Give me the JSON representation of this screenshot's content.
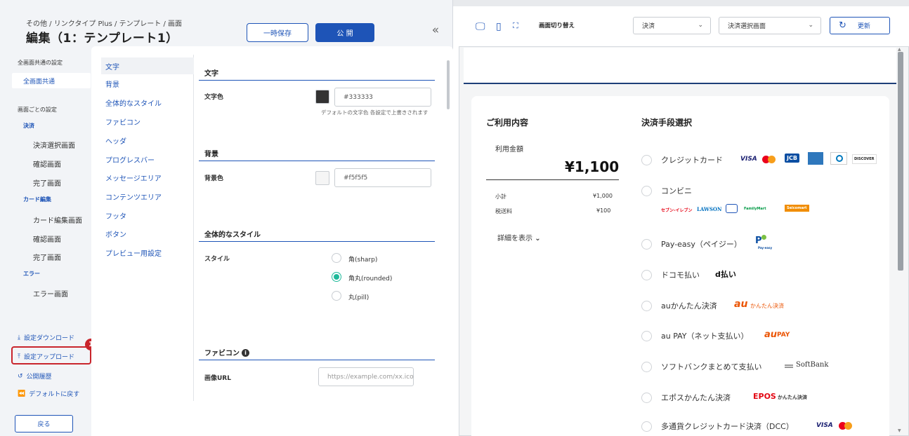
{
  "header": {
    "breadcrumb": "その他 / リンクタイプ Plus / テンプレート / 画面",
    "title": "編集（1：テンプレート1）",
    "save_label": "一時保存",
    "publish_label": "公 開"
  },
  "nav": {
    "common_heading": "全画面共通の設定",
    "common_item": "全画面共通",
    "per_screen_heading": "画面ごとの設定",
    "groups": [
      {
        "label": "決済",
        "items": [
          "決済選択画面",
          "確認画面",
          "完了画面"
        ]
      },
      {
        "label": "カード編集",
        "items": [
          "カード編集画面",
          "確認画面",
          "完了画面"
        ]
      },
      {
        "label": "エラー",
        "items": [
          "エラー画面"
        ]
      }
    ],
    "tools": {
      "download": "設定ダウンロード",
      "upload": "設定アップロード",
      "history": "公開履歴",
      "reset": "デフォルトに戻す"
    },
    "badge": "1",
    "back_label": "戻る"
  },
  "categories": [
    "文字",
    "背景",
    "全体的なスタイル",
    "ファビコン",
    "ヘッダ",
    "プログレスバー",
    "メッセージエリア",
    "コンテンツエリア",
    "フッタ",
    "ボタン",
    "プレビュー用設定"
  ],
  "form": {
    "text_section": "文字",
    "text_color_label": "文字色",
    "text_color_value": "#333333",
    "text_help": "デフォルトの文字色 各設定で上書きされます",
    "bg_section": "背景",
    "bg_color_label": "背景色",
    "bg_color_value": "#f5f5f5",
    "style_section": "全体的なスタイル",
    "style_label": "スタイル",
    "style_options": [
      "角(sharp)",
      "角丸(rounded)",
      "丸(pill)"
    ],
    "favicon_section": "ファビコン",
    "image_url_label": "画像URL",
    "image_url_placeholder": "https://example.com/xx.ico"
  },
  "preview_toolbar": {
    "switch_label": "画面切り替え",
    "select1": "決済",
    "select2": "決済選択画面",
    "refresh_label": "更新"
  },
  "preview": {
    "usage_title": "ご利用内容",
    "amount_label": "利用金額",
    "amount": "¥1,100",
    "subtotal_label": "小計",
    "subtotal": "¥1,000",
    "shipping_label": "税送料",
    "shipping": "¥100",
    "detail_label": "詳細を表示",
    "method_title": "決済手段選択",
    "methods": [
      "クレジットカード",
      "コンビニ",
      "Pay-easy（ペイジー）",
      "ドコモ払い",
      "auかんたん決済",
      "au PAY（ネット支払い）",
      "ソフトバンクまとめて支払い",
      "エポスかんたん決済",
      "多通貨クレジットカード決済（DCC）"
    ],
    "logos": {
      "visa": "VISA",
      "jcb": "JCB",
      "discover": "DISCOVER",
      "seven": "セブン-イレブン",
      "lawson": "LAWSON",
      "familymart": "FamilyMart",
      "seicomart": "Seicomart",
      "payeasy": "Pay-easy",
      "dbarai": "d払い",
      "au_kantan": "かんたん決済",
      "au_pay": "PAY",
      "softbank": "SoftBank",
      "epos": "EPOS",
      "epos_sub": "かんたん決済"
    }
  }
}
